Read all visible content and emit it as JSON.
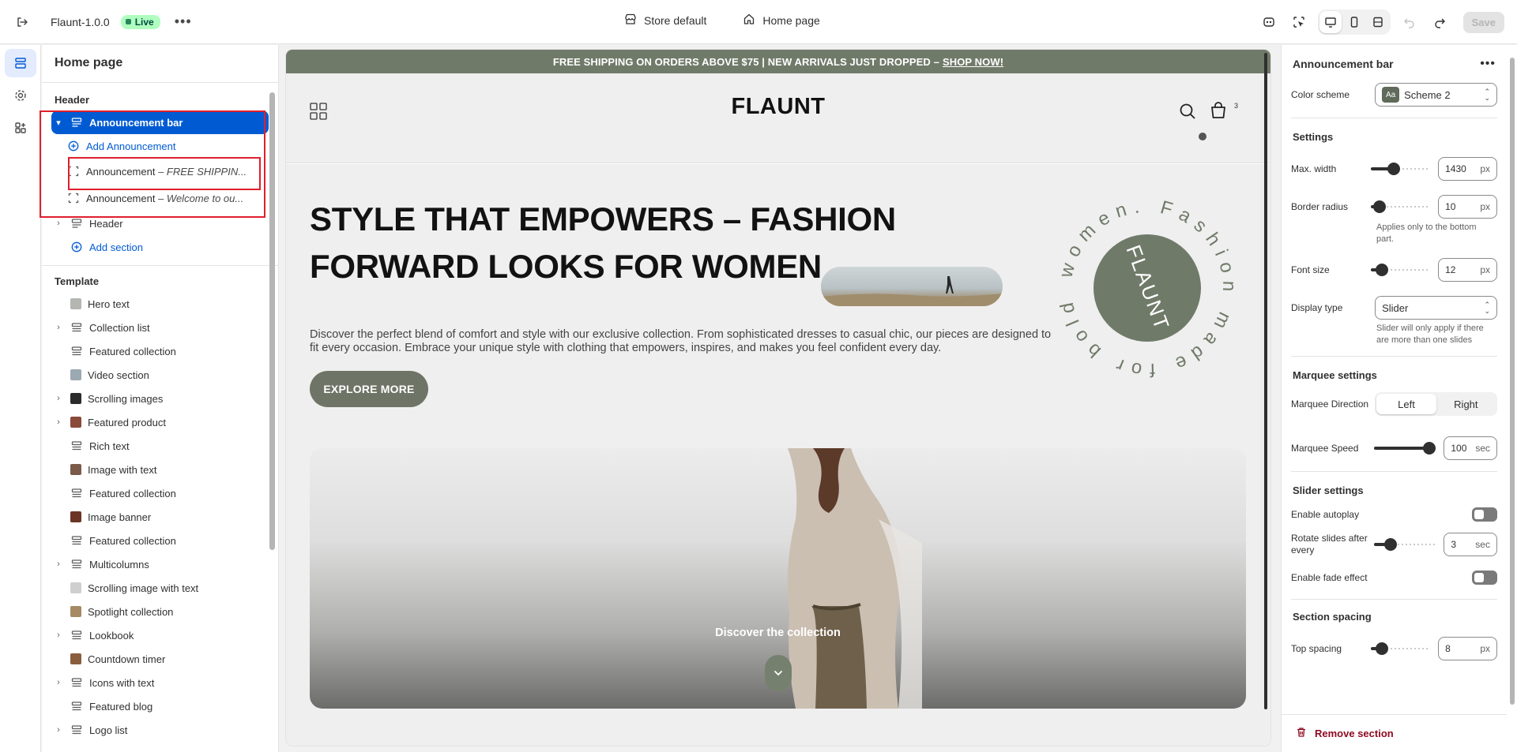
{
  "topbar": {
    "theme_name": "Flaunt-1.0.0",
    "status_badge": "Live",
    "store_selector": "Store default",
    "page_selector": "Home page",
    "save_label": "Save"
  },
  "left_panel": {
    "title": "Home page",
    "header_group_label": "Header",
    "announcement_bar_label": "Announcement bar",
    "add_announcement_label": "Add Announcement",
    "announcement_1": {
      "prefix": "Announcement",
      "suffix": "– FREE SHIPPIN..."
    },
    "announcement_2": {
      "prefix": "Announcement",
      "suffix": "– Welcome to ou..."
    },
    "header_section_label": "Header",
    "add_section_label": "Add section",
    "template_group_label": "Template",
    "template_items": [
      {
        "label": "Hero text",
        "expandable": false,
        "thumb": "#b4b6b2"
      },
      {
        "label": "Collection list",
        "expandable": true,
        "thumb": ""
      },
      {
        "label": "Featured collection",
        "expandable": false,
        "thumb": ""
      },
      {
        "label": "Video section",
        "expandable": false,
        "thumb": "#9aa9b2"
      },
      {
        "label": "Scrolling images",
        "expandable": true,
        "thumb": "#2b2b2b"
      },
      {
        "label": "Featured product",
        "expandable": true,
        "thumb": "#8a4a3a"
      },
      {
        "label": "Rich text",
        "expandable": false,
        "thumb": ""
      },
      {
        "label": "Image with text",
        "expandable": false,
        "thumb": "#7b5a4a"
      },
      {
        "label": "Featured collection",
        "expandable": false,
        "thumb": ""
      },
      {
        "label": "Image banner",
        "expandable": false,
        "thumb": "#6b3426"
      },
      {
        "label": "Featured collection",
        "expandable": false,
        "thumb": ""
      },
      {
        "label": "Multicolumns",
        "expandable": true,
        "thumb": ""
      },
      {
        "label": "Scrolling image with text",
        "expandable": false,
        "thumb": "#cfcfcf"
      },
      {
        "label": "Spotlight collection",
        "expandable": false,
        "thumb": "#a58a64"
      },
      {
        "label": "Lookbook",
        "expandable": true,
        "thumb": ""
      },
      {
        "label": "Countdown timer",
        "expandable": false,
        "thumb": "#8a5d3d"
      },
      {
        "label": "Icons with text",
        "expandable": true,
        "thumb": ""
      },
      {
        "label": "Featured blog",
        "expandable": false,
        "thumb": ""
      },
      {
        "label": "Logo list",
        "expandable": true,
        "thumb": ""
      }
    ]
  },
  "preview": {
    "announcement_text": "FREE SHIPPING ON ORDERS ABOVE $75 | NEW ARRIVALS JUST DROPPED –",
    "announcement_link": "SHOP NOW!",
    "logo": "FLAUNT",
    "cart_count": "3",
    "hero_heading": "STYLE THAT EMPOWERS – FASHION FORWARD LOOKS FOR WOMEN",
    "hero_body": "Discover the perfect blend of comfort and style with our exclusive collection. From sophisticated dresses to casual chic, our pieces are designed to fit every occasion. Embrace your unique style with clothing that empowers, inspires, and makes you feel confident every day.",
    "hero_cta": "EXPLORE MORE",
    "badge_ring_text": "women. Fashion made for bold",
    "badge_center": "FLAUNT",
    "banner_caption": "Discover the collection"
  },
  "right_panel": {
    "title": "Announcement bar",
    "color_scheme_label": "Color scheme",
    "color_scheme_value": "Scheme 2",
    "color_scheme_swatch": "Aa",
    "settings_title": "Settings",
    "max_width": {
      "label": "Max. width",
      "value": "1430",
      "unit": "px",
      "level": 0.35
    },
    "border_radius": {
      "label": "Border radius",
      "value": "10",
      "unit": "px",
      "level": 0.05,
      "help": "Applies only to the bottom part."
    },
    "font_size": {
      "label": "Font size",
      "value": "12",
      "unit": "px",
      "level": 0.1
    },
    "display_type": {
      "label": "Display type",
      "value": "Slider",
      "help": "Slider will only apply if there are more than one slides"
    },
    "marquee_title": "Marquee settings",
    "marquee_direction": {
      "label": "Marquee Direction",
      "options": [
        "Left",
        "Right"
      ],
      "selected": "Left"
    },
    "marquee_speed": {
      "label": "Marquee Speed",
      "value": "100",
      "unit": "sec",
      "level": 1.0
    },
    "slider_title": "Slider settings",
    "enable_autoplay_label": "Enable autoplay",
    "rotate_slides": {
      "label": "Rotate slides after every",
      "value": "3",
      "unit": "sec",
      "level": 0.2
    },
    "enable_fade_label": "Enable fade effect",
    "section_spacing_title": "Section spacing",
    "top_spacing": {
      "label": "Top spacing",
      "value": "8",
      "unit": "px",
      "level": 0.1
    },
    "remove_section_label": "Remove section"
  }
}
